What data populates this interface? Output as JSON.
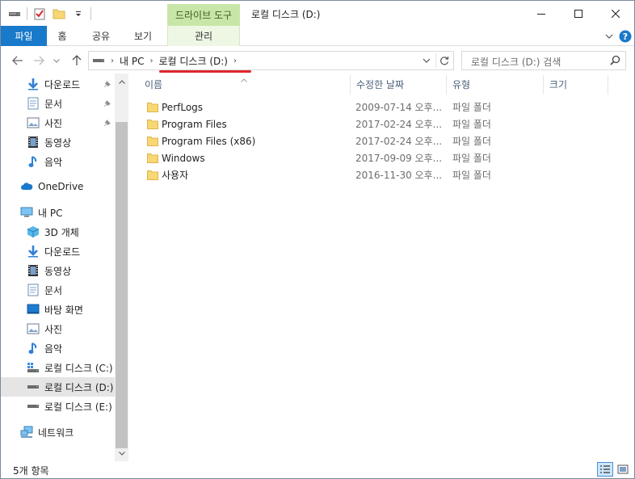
{
  "window": {
    "title": "로컬 디스크 (D:)",
    "context_tab": "드라이브 도구"
  },
  "ribbon": {
    "tabs": [
      "파일",
      "홈",
      "공유",
      "보기"
    ],
    "context_sub_tab": "관리"
  },
  "address": {
    "crumbs": [
      "내 PC",
      "로컬 디스크 (D:)"
    ],
    "search_placeholder": "로컬 디스크 (D:) 검색"
  },
  "nav": {
    "quick_access": [
      {
        "label": "다운로드",
        "icon": "download-icon",
        "pinned": true
      },
      {
        "label": "문서",
        "icon": "document-icon",
        "pinned": true
      },
      {
        "label": "사진",
        "icon": "pictures-icon",
        "pinned": true
      },
      {
        "label": "동영상",
        "icon": "video-icon",
        "pinned": false
      },
      {
        "label": "음악",
        "icon": "music-icon",
        "pinned": false
      }
    ],
    "onedrive": "OneDrive",
    "this_pc": "내 PC",
    "this_pc_children": [
      {
        "label": "3D 개체",
        "icon": "3d-objects-icon"
      },
      {
        "label": "다운로드",
        "icon": "download-icon"
      },
      {
        "label": "동영상",
        "icon": "video-icon"
      },
      {
        "label": "문서",
        "icon": "document-icon"
      },
      {
        "label": "바탕 화면",
        "icon": "desktop-icon"
      },
      {
        "label": "사진",
        "icon": "pictures-icon"
      },
      {
        "label": "음악",
        "icon": "music-icon"
      },
      {
        "label": "로컬 디스크 (C:)",
        "icon": "system-drive-icon"
      },
      {
        "label": "로컬 디스크 (D:)",
        "icon": "drive-icon",
        "selected": true
      },
      {
        "label": "로컬 디스크 (E:)",
        "icon": "drive-icon"
      }
    ],
    "network": "네트워크"
  },
  "list": {
    "columns": [
      "이름",
      "수정한 날짜",
      "유형",
      "크기"
    ],
    "rows": [
      {
        "name": "PerfLogs",
        "date": "2009-07-14 오후...",
        "type": "파일 폴더"
      },
      {
        "name": "Program Files",
        "date": "2017-02-24 오후...",
        "type": "파일 폴더"
      },
      {
        "name": "Program Files (x86)",
        "date": "2017-02-24 오후...",
        "type": "파일 폴더"
      },
      {
        "name": "Windows",
        "date": "2017-09-09 오후...",
        "type": "파일 폴더"
      },
      {
        "name": "사용자",
        "date": "2016-11-30 오후...",
        "type": "파일 폴더"
      }
    ]
  },
  "status": {
    "item_count": "5개 항목"
  },
  "colors": {
    "file_tab": "#1979ca",
    "context_tab": "#c8e6a8",
    "folder": "#f8d775",
    "annotation": "#e0262b"
  }
}
